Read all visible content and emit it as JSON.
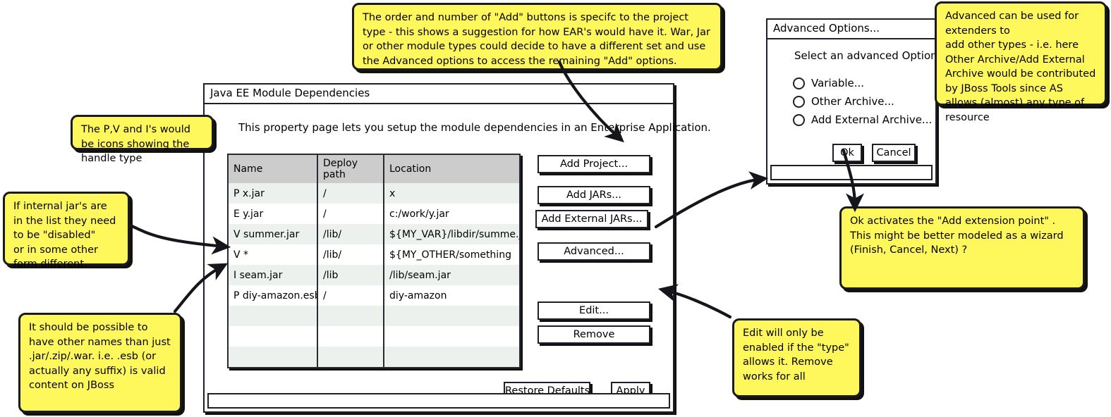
{
  "main_window": {
    "title": "Java EE Module Dependencies",
    "description": "This property page lets you setup the module dependencies in an Enterprise Application.",
    "table": {
      "columns": [
        "Name",
        "Deploy path",
        "Location"
      ],
      "rows": [
        {
          "name": "P x.jar",
          "deploy_path": "/",
          "location": "x"
        },
        {
          "name": "E y.jar",
          "deploy_path": "/",
          "location": "c:/work/y.jar"
        },
        {
          "name": "V summer.jar",
          "deploy_path": "/lib/",
          "location": "${MY_VAR}/libdir/summe.jar"
        },
        {
          "name": "V *",
          "deploy_path": "/lib/",
          "location": "${MY_OTHER/something"
        },
        {
          "name": "I seam.jar",
          "deploy_path": "/lib",
          "location": "/lib/seam.jar"
        },
        {
          "name": "P diy-amazon.esb",
          "deploy_path": "/",
          "location": "diy-amazon"
        },
        {
          "name": "",
          "deploy_path": "",
          "location": ""
        },
        {
          "name": "",
          "deploy_path": "",
          "location": ""
        },
        {
          "name": "",
          "deploy_path": "",
          "location": ""
        },
        {
          "name": "",
          "deploy_path": "",
          "location": ""
        }
      ]
    },
    "side_buttons": {
      "add_project": "Add Project...",
      "add_jars": "Add JARs...",
      "add_external_jars": "Add External JARs...",
      "advanced": "Advanced...",
      "edit": "Edit...",
      "remove": "Remove"
    },
    "footer_buttons": {
      "restore_defaults": "Restore Defaults",
      "apply": "Apply"
    }
  },
  "advanced_dialog": {
    "title": "Advanced Options...",
    "prompt": "Select an advanced Option:",
    "options": [
      "Variable...",
      "Other Archive...",
      "Add External Archive..."
    ],
    "ok_label": "Ok",
    "cancel_label": "Cancel"
  },
  "notes": {
    "add_buttons": "The order and number of \"Add\" buttons is specifc to the project type - this shows a suggestion for how EAR's would have it. War, Jar or other module types could decide to have a different set and use the Advanced options to access the remaining \"Add\" options.",
    "advanced_extenders": "Advanced can be used for extenders to\nadd other types - i.e. here Other Archive/Add External Archive would be contributed by JBoss Tools since AS allows (almost) any type of resource",
    "handle_icons": "The P,V and I's would be icons showing the handle type",
    "internal_jars": "If internal jar's are in the list they need to be \"disabled\"\nor in some other form different.",
    "other_names": "It should be possible to have other names than just .jar/.zip/.war. i.e. .esb (or actually any suffix) is valid content on JBoss",
    "ok_wizard": "Ok activates the \"Add extension point\" . This might be better modeled as a wizard (Finish, Cancel, Next) ?",
    "edit_remove": "Edit will only be enabled if the \"type\" allows it. Remove works for all"
  },
  "colors": {
    "note_yellow": "#FFF85C",
    "ink": "#1F1F28",
    "table_header": "#CCCCCC",
    "row_alt": "#ECF1ED"
  }
}
